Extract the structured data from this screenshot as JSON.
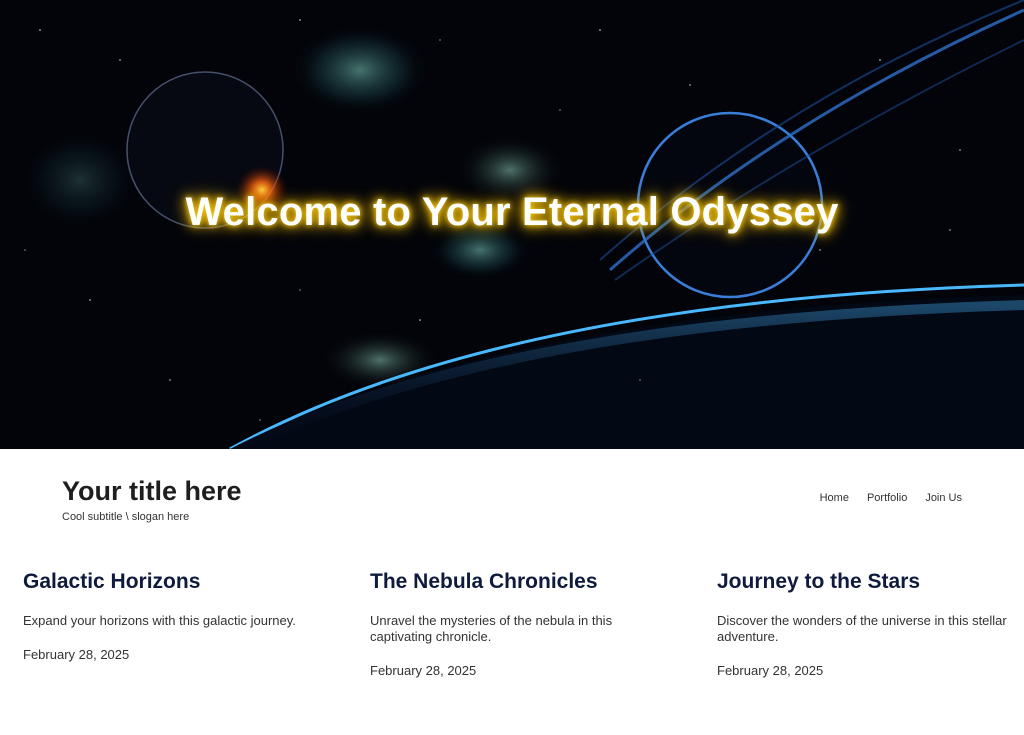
{
  "hero": {
    "title": "Welcome to Your Eternal Odyssey"
  },
  "header": {
    "title": "Your title here",
    "subtitle": "Cool subtitle \\ slogan here"
  },
  "nav": {
    "items": [
      {
        "label": "Home"
      },
      {
        "label": "Portfolio"
      },
      {
        "label": "Join Us"
      }
    ]
  },
  "posts": [
    {
      "title": "Galactic Horizons",
      "excerpt": "Expand your horizons with this galactic journey.",
      "date": "February 28, 2025"
    },
    {
      "title": "The Nebula Chronicles",
      "excerpt": "Unravel the mysteries of the nebula in this captivating chronicle.",
      "date": "February 28, 2025"
    },
    {
      "title": "Journey to the Stars",
      "excerpt": "Discover the wonders of the universe in this stellar adventure.",
      "date": "February 28, 2025"
    }
  ],
  "colors": {
    "hero_glow": "#ffc400",
    "heading": "#0f1b3d",
    "planet_rim": "#3aa0ff"
  }
}
